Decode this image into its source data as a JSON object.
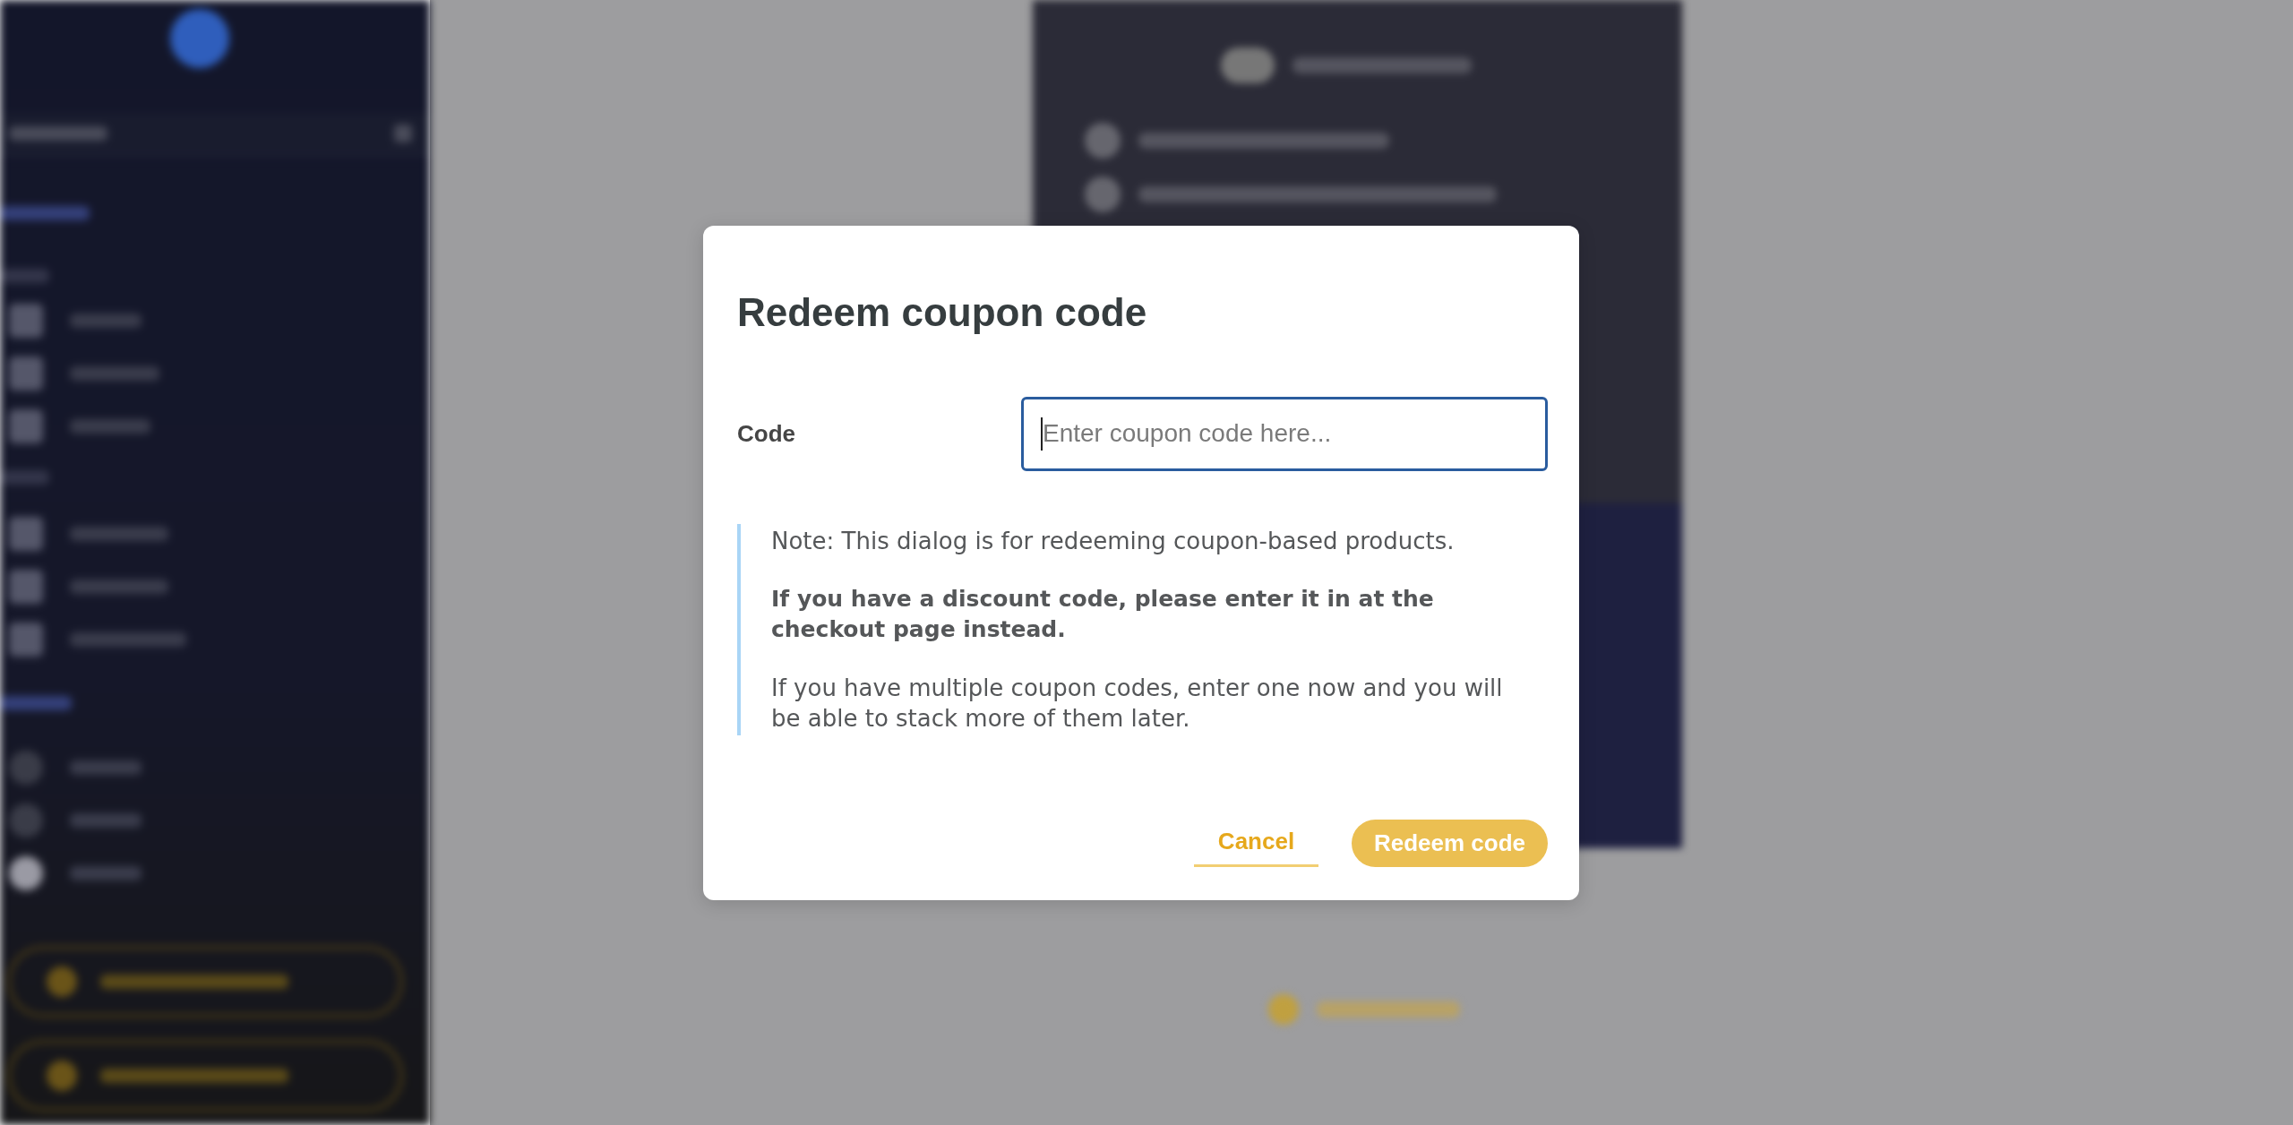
{
  "dialog": {
    "title": "Redeem coupon code",
    "code_field": {
      "label": "Code",
      "placeholder": "Enter coupon code here...",
      "focused": true
    },
    "note": [
      {
        "text": "Note: This dialog is for redeeming coupon-based products.",
        "bold": false
      },
      {
        "text": "If you have a discount code, please enter it in at the checkout page instead.",
        "bold": true
      },
      {
        "text": "If you have multiple coupon codes, enter one now and you will be able to stack more of them later.",
        "bold": false
      }
    ],
    "buttons": [
      {
        "label": "Cancel",
        "kind": "link",
        "disabled": false
      },
      {
        "label": "Redeem code",
        "kind": "primary",
        "disabled": true
      }
    ]
  }
}
